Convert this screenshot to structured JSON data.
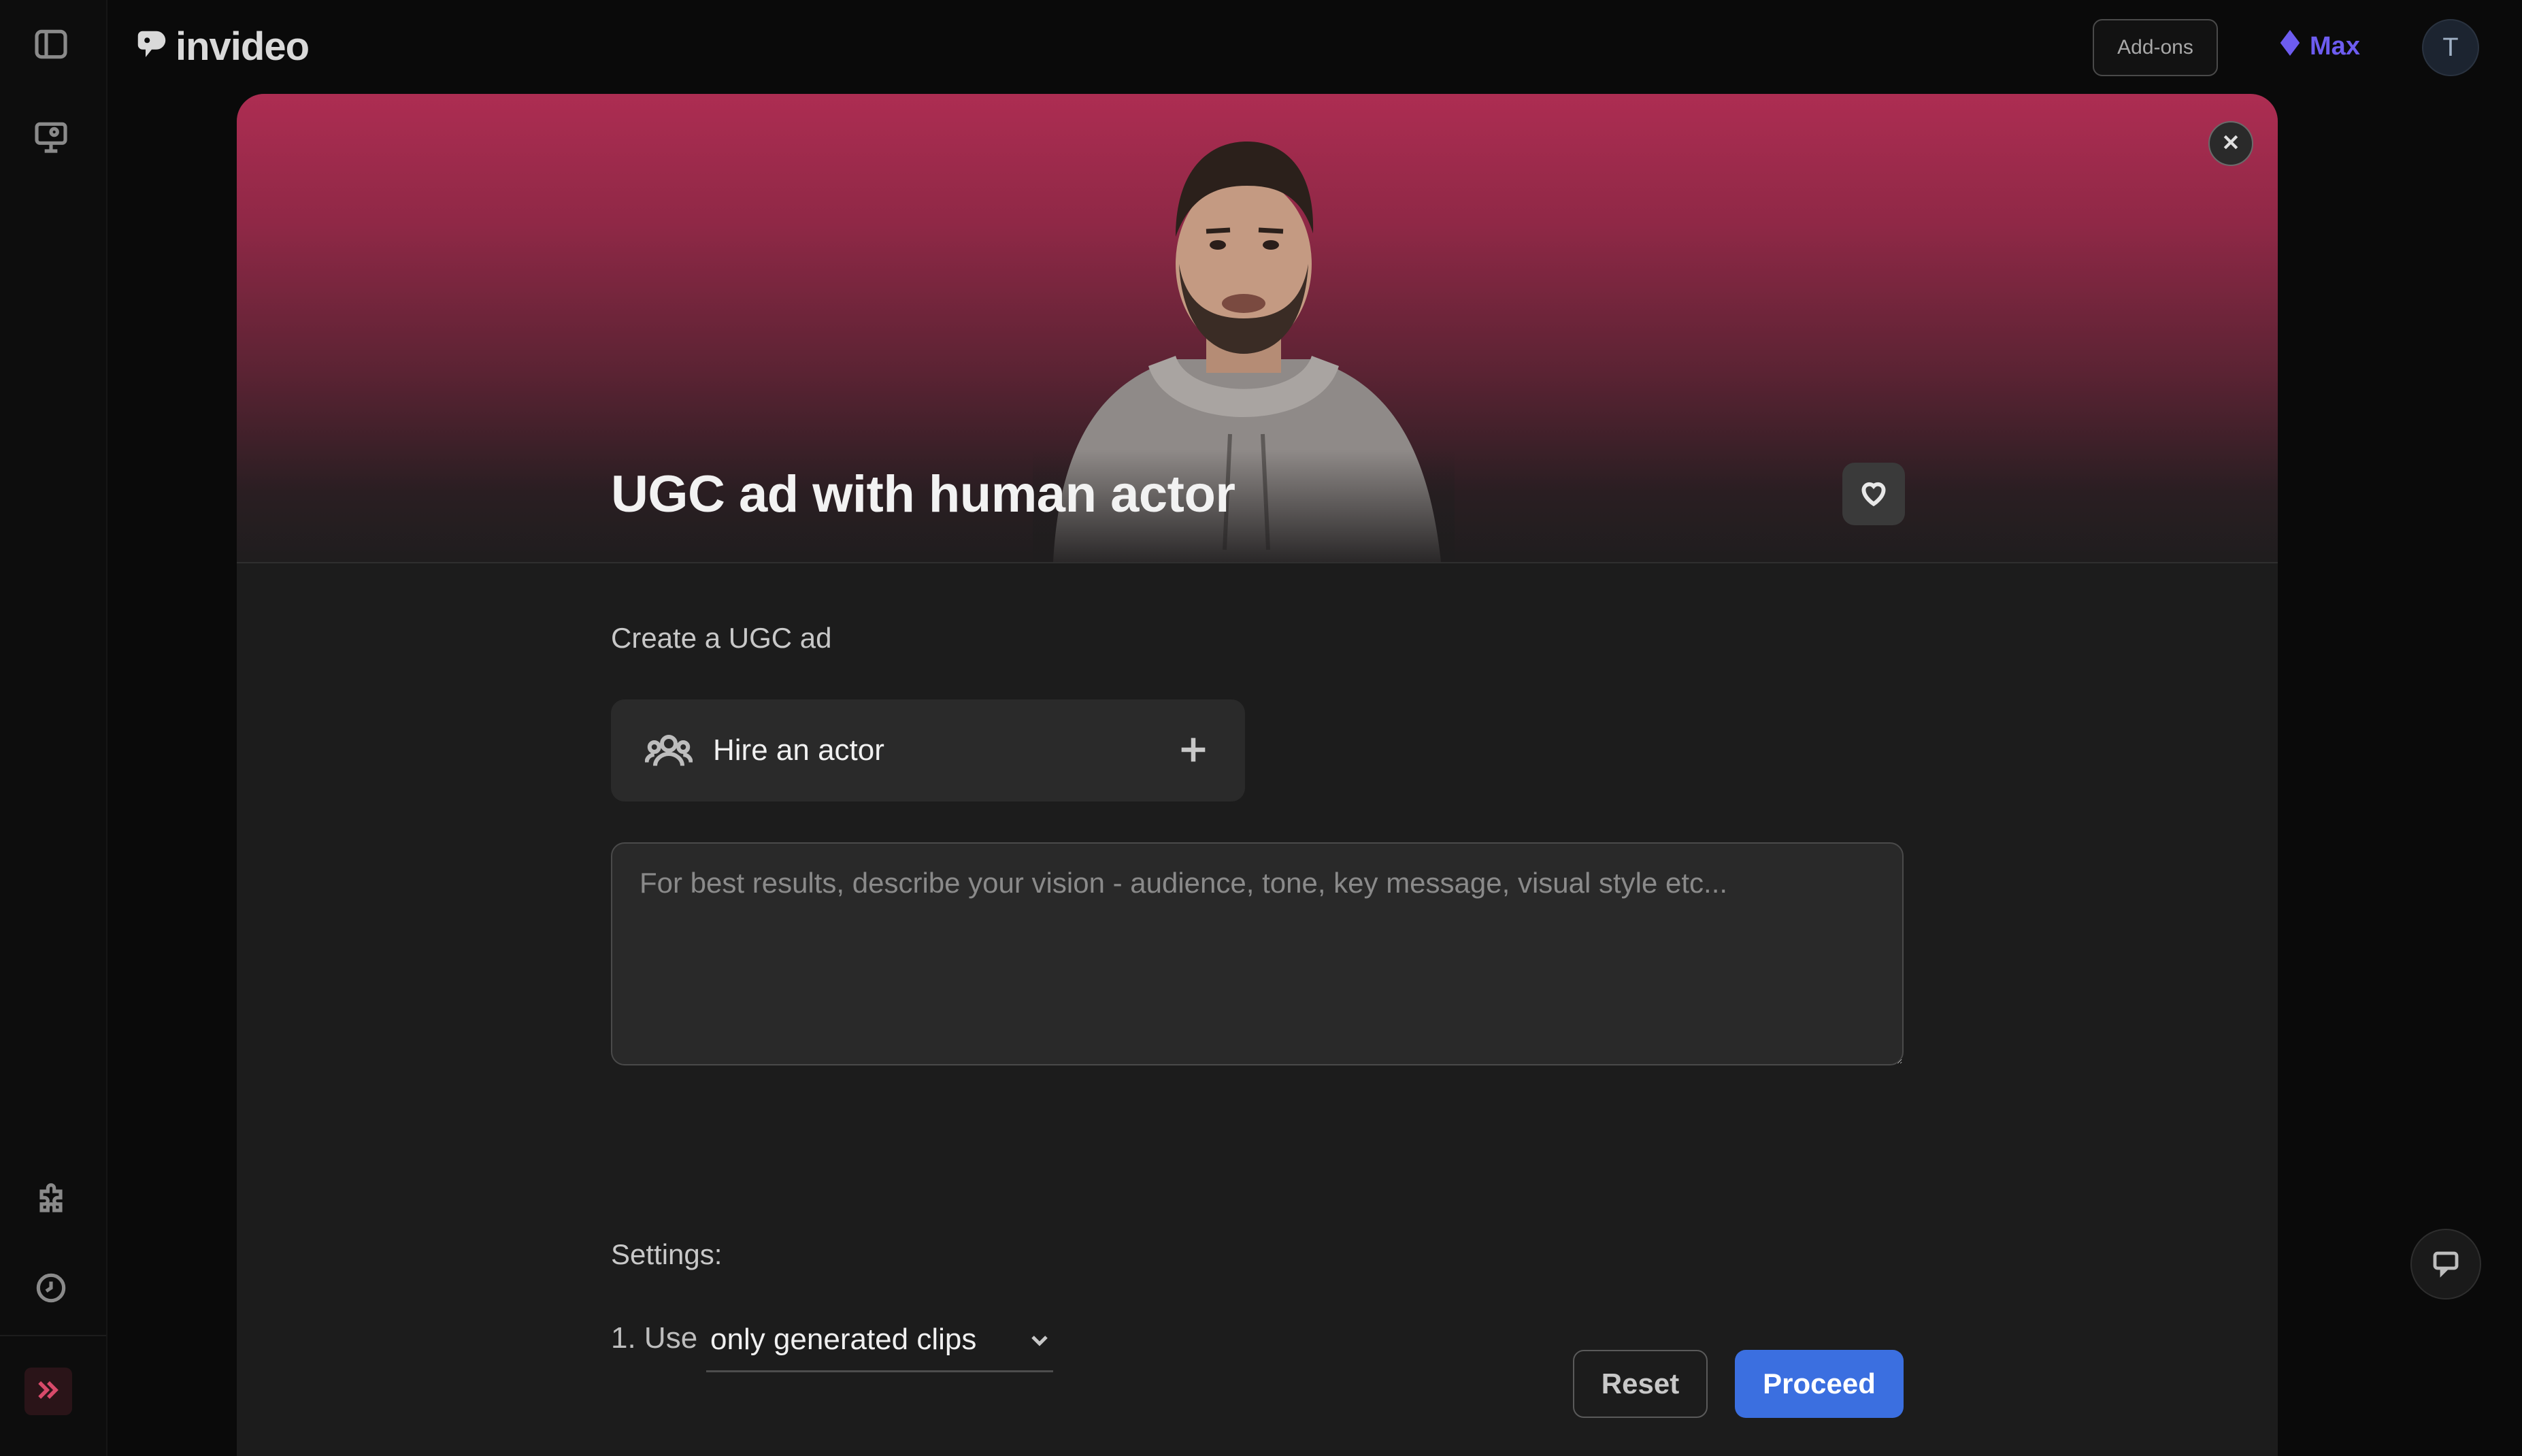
{
  "app": {
    "brand": "invideo"
  },
  "header": {
    "addons_label": "Add-ons",
    "plan_label": "Max",
    "avatar_initial": "T"
  },
  "modal": {
    "title": "UGC ad with human actor",
    "section_label": "Create a UGC ad",
    "hire_actor_label": "Hire an actor",
    "prompt": {
      "value": "",
      "placeholder": "For best results, describe your vision - audience, tone, key message, visual style etc..."
    },
    "settings_label": "Settings:",
    "use_prefix": "1. Use",
    "use_selected": "only generated clips",
    "reset_label": "Reset",
    "proceed_label": "Proceed"
  },
  "colors": {
    "accent": "#3b6fe0",
    "hero_top": "#ad2d52",
    "plan": "#6d5cf0",
    "expand_accent": "#d84a6a"
  },
  "icons": {
    "rail_top": [
      "sidebar-toggle-icon",
      "presentation-icon"
    ],
    "rail_bottom": [
      "puzzle-icon",
      "history-icon",
      "expand-chevrons-icon"
    ]
  }
}
